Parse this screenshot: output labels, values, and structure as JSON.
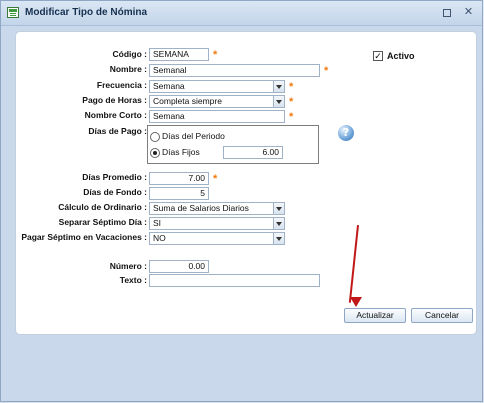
{
  "window": {
    "title": "Modificar Tipo de Nómina"
  },
  "form": {
    "codigo": {
      "label": "Código :",
      "value": "SEMANA"
    },
    "activo": {
      "label": "Activo",
      "checked": true
    },
    "nombre": {
      "label": "Nombre :",
      "value": "Semanal"
    },
    "frecuencia": {
      "label": "Frecuencia :",
      "value": "Semana"
    },
    "pago_horas": {
      "label": "Pago de Horas :",
      "value": "Completa siempre"
    },
    "nombre_corto": {
      "label": "Nombre Corto :",
      "value": "Semana"
    },
    "dias_pago": {
      "label": "Días de Pago :",
      "option1": "Días del Periodo",
      "option2": "Días Fijos",
      "option2_value": "6.00",
      "selected": "option2"
    },
    "dias_promedio": {
      "label": "Días Promedio :",
      "value": "7.00"
    },
    "dias_fondo": {
      "label": "Días de Fondo :",
      "value": "5"
    },
    "calculo_ordinario": {
      "label": "Cálculo de Ordinario :",
      "value": "Suma de Salarios Diarios"
    },
    "separar_septimo": {
      "label": "Separar Séptimo Día :",
      "value": "SI"
    },
    "pagar_septimo": {
      "label": "Pagar Séptimo en Vacaciones :",
      "value": "NO"
    },
    "numero": {
      "label": "Número :",
      "value": "0.00"
    },
    "texto": {
      "label": "Texto :",
      "value": ""
    }
  },
  "buttons": {
    "actualizar": "Actualizar",
    "cancelar": "Cancelar"
  },
  "icons": {
    "help": "?",
    "required": "*",
    "close": "✕",
    "checkmark": "✓"
  },
  "colors": {
    "required": "#f07a10",
    "annotation_arrow": "#c01818"
  }
}
